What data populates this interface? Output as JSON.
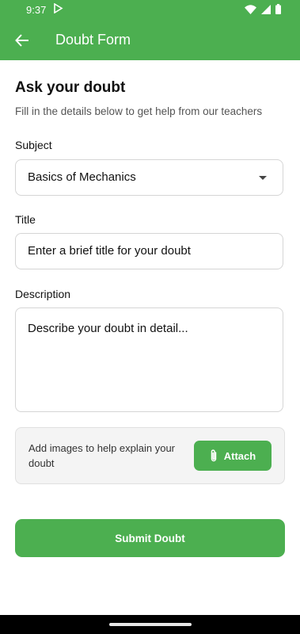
{
  "status_bar": {
    "time": "9:37"
  },
  "app_bar": {
    "title": "Doubt Form"
  },
  "form": {
    "heading": "Ask your doubt",
    "subheading": "Fill in the details below to get help from our teachers",
    "subject": {
      "label": "Subject",
      "value": "Basics of Mechanics"
    },
    "title": {
      "label": "Title",
      "placeholder": "Enter a brief title for your doubt"
    },
    "description": {
      "label": "Description",
      "placeholder": "Describe your doubt in detail..."
    },
    "attachment": {
      "text": "Add images to help explain your doubt",
      "button_label": "Attach"
    },
    "submit_label": "Submit Doubt"
  },
  "colors": {
    "primary": "#4caf50",
    "field_border": "#d5d5d5",
    "attach_bg": "#f4f4f4"
  }
}
